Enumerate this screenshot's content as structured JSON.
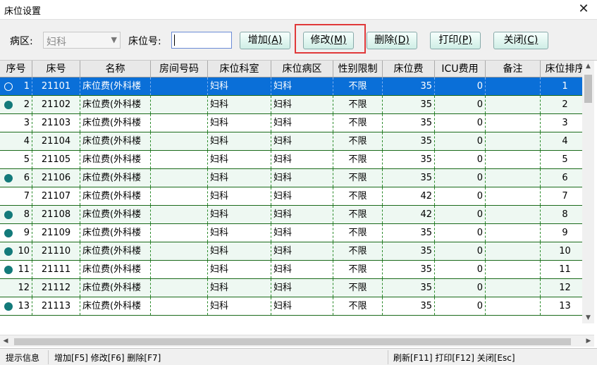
{
  "window": {
    "title": "床位设置",
    "close_glyph": "✕"
  },
  "toolbar": {
    "ward_label": "病区:",
    "ward_value": "妇科",
    "bed_label": "床位号:",
    "bed_value": "",
    "buttons": {
      "add": {
        "text": "增加",
        "key": "(A)"
      },
      "edit": {
        "text": "修改",
        "key": "(M)"
      },
      "delete": {
        "text": "删除",
        "key": "(D)"
      },
      "print": {
        "text": "打印",
        "key": "(P)"
      },
      "close": {
        "text": "关闭",
        "key": "(C)"
      }
    }
  },
  "table": {
    "columns": [
      "序号",
      "床号",
      "名称",
      "房间号码",
      "床位科室",
      "床位病区",
      "性别限制",
      "床位费",
      "ICU费用",
      "备注",
      "床位排序"
    ],
    "rows": [
      {
        "seq": "1",
        "bed": "21101",
        "name": "床位费(外科楼",
        "room": "",
        "dept": "妇科",
        "ward": "妇科",
        "gender": "不限",
        "fee": "35",
        "icu": "0",
        "note": "",
        "order": "1",
        "marker": "hollow",
        "selected": true
      },
      {
        "seq": "2",
        "bed": "21102",
        "name": "床位费(外科楼",
        "room": "",
        "dept": "妇科",
        "ward": "妇科",
        "gender": "不限",
        "fee": "35",
        "icu": "0",
        "note": "",
        "order": "2",
        "marker": "filled"
      },
      {
        "seq": "3",
        "bed": "21103",
        "name": "床位费(外科楼",
        "room": "",
        "dept": "妇科",
        "ward": "妇科",
        "gender": "不限",
        "fee": "35",
        "icu": "0",
        "note": "",
        "order": "3",
        "marker": "none"
      },
      {
        "seq": "4",
        "bed": "21104",
        "name": "床位费(外科楼",
        "room": "",
        "dept": "妇科",
        "ward": "妇科",
        "gender": "不限",
        "fee": "35",
        "icu": "0",
        "note": "",
        "order": "4",
        "marker": "none"
      },
      {
        "seq": "5",
        "bed": "21105",
        "name": "床位费(外科楼",
        "room": "",
        "dept": "妇科",
        "ward": "妇科",
        "gender": "不限",
        "fee": "35",
        "icu": "0",
        "note": "",
        "order": "5",
        "marker": "none"
      },
      {
        "seq": "6",
        "bed": "21106",
        "name": "床位费(外科楼",
        "room": "",
        "dept": "妇科",
        "ward": "妇科",
        "gender": "不限",
        "fee": "35",
        "icu": "0",
        "note": "",
        "order": "6",
        "marker": "filled"
      },
      {
        "seq": "7",
        "bed": "21107",
        "name": "床位费(外科楼",
        "room": "",
        "dept": "妇科",
        "ward": "妇科",
        "gender": "不限",
        "fee": "42",
        "icu": "0",
        "note": "",
        "order": "7",
        "marker": "none"
      },
      {
        "seq": "8",
        "bed": "21108",
        "name": "床位费(外科楼",
        "room": "",
        "dept": "妇科",
        "ward": "妇科",
        "gender": "不限",
        "fee": "42",
        "icu": "0",
        "note": "",
        "order": "8",
        "marker": "filled"
      },
      {
        "seq": "9",
        "bed": "21109",
        "name": "床位费(外科楼",
        "room": "",
        "dept": "妇科",
        "ward": "妇科",
        "gender": "不限",
        "fee": "35",
        "icu": "0",
        "note": "",
        "order": "9",
        "marker": "filled"
      },
      {
        "seq": "10",
        "bed": "21110",
        "name": "床位费(外科楼",
        "room": "",
        "dept": "妇科",
        "ward": "妇科",
        "gender": "不限",
        "fee": "35",
        "icu": "0",
        "note": "",
        "order": "10",
        "marker": "filled"
      },
      {
        "seq": "11",
        "bed": "21111",
        "name": "床位费(外科楼",
        "room": "",
        "dept": "妇科",
        "ward": "妇科",
        "gender": "不限",
        "fee": "35",
        "icu": "0",
        "note": "",
        "order": "11",
        "marker": "filled"
      },
      {
        "seq": "12",
        "bed": "21112",
        "name": "床位费(外科楼",
        "room": "",
        "dept": "妇科",
        "ward": "妇科",
        "gender": "不限",
        "fee": "35",
        "icu": "0",
        "note": "",
        "order": "12",
        "marker": "none"
      },
      {
        "seq": "13",
        "bed": "21113",
        "name": "床位费(外科楼",
        "room": "",
        "dept": "妇科",
        "ward": "妇科",
        "gender": "不限",
        "fee": "35",
        "icu": "0",
        "note": "",
        "order": "13",
        "marker": "filled"
      }
    ]
  },
  "status": {
    "info": "提示信息",
    "shortcuts_left": "增加[F5] 修改[F6] 删除[F7]",
    "shortcuts_right": "刷新[F11] 打印[F12] 关闭[Esc]"
  },
  "colors": {
    "selected_row": "#0a6fd8",
    "even_row": "#eef8f2",
    "marker": "#137a7a",
    "highlight": "#e0393a"
  }
}
